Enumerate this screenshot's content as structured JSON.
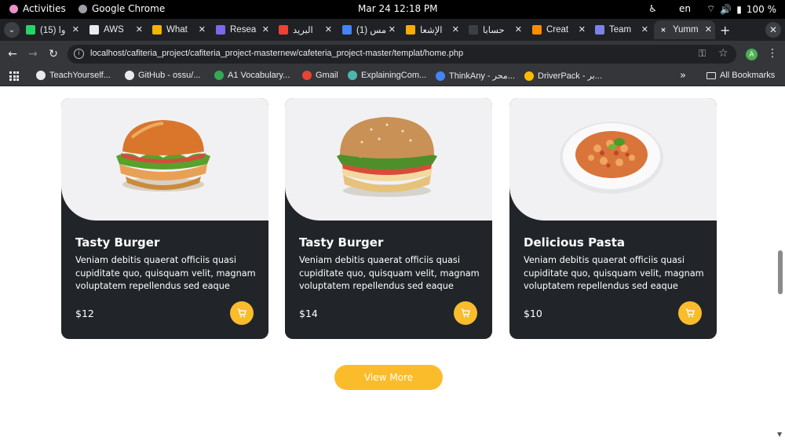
{
  "system": {
    "activities": "Activities",
    "app_name": "Google Chrome",
    "clock": "Mar 24  12:18 PM",
    "language": "en",
    "battery": "100 %"
  },
  "tabs": [
    {
      "label": "(15) وا",
      "color": "#25d366"
    },
    {
      "label": "AWS",
      "color": "#e8eaed"
    },
    {
      "label": "What",
      "color": "#f4b400"
    },
    {
      "label": "Resea",
      "color": "#7b68ee"
    },
    {
      "label": "البريد",
      "color": "#ea4335"
    },
    {
      "label": "(1) مس",
      "color": "#4285f4"
    },
    {
      "label": "الإشعا",
      "color": "#f9ab00"
    },
    {
      "label": "حسابا",
      "color": "#3c4043"
    },
    {
      "label": "Creat",
      "color": "#fb8c00"
    },
    {
      "label": "Team",
      "color": "#7b83eb"
    },
    {
      "label": "Yumm",
      "color": "#202124"
    }
  ],
  "toolbar": {
    "url": "localhost/cafiteria_project/cafiteria_project-masternew/cafeteria_project-master/templat/home.php",
    "profile_initial": "A"
  },
  "bookmarks": [
    {
      "label": "TeachYourself...",
      "color": "#e8eaed"
    },
    {
      "label": "GitHub - ossu/...",
      "color": "#e8eaed"
    },
    {
      "label": "A1 Vocabulary...",
      "color": "#34a853"
    },
    {
      "label": "Gmail",
      "color": "#ea4335"
    },
    {
      "label": "ExplainingCom...",
      "color": "#4db6ac"
    },
    {
      "label": "ThinkAny - محر...",
      "color": "#4285f4"
    },
    {
      "label": "DriverPack - بر...",
      "color": "#fbbc04"
    }
  ],
  "bookmarks_all": "All Bookmarks",
  "menu": [
    {
      "title": "Tasty Burger",
      "description": "Veniam debitis quaerat officiis quasi cupiditate quo, quisquam velit, magnam voluptatem repellendus sed eaque",
      "price": "$12"
    },
    {
      "title": "Tasty Burger",
      "description": "Veniam debitis quaerat officiis quasi cupiditate quo, quisquam velit, magnam voluptatem repellendus sed eaque",
      "price": "$14"
    },
    {
      "title": "Delicious Pasta",
      "description": "Veniam debitis quaerat officiis quasi cupiditate quo, quisquam velit, magnam voluptatem repellendus sed eaque",
      "price": "$10"
    }
  ],
  "view_more": "View More",
  "colors": {
    "accent": "#fbbc2c",
    "card": "#212529"
  }
}
